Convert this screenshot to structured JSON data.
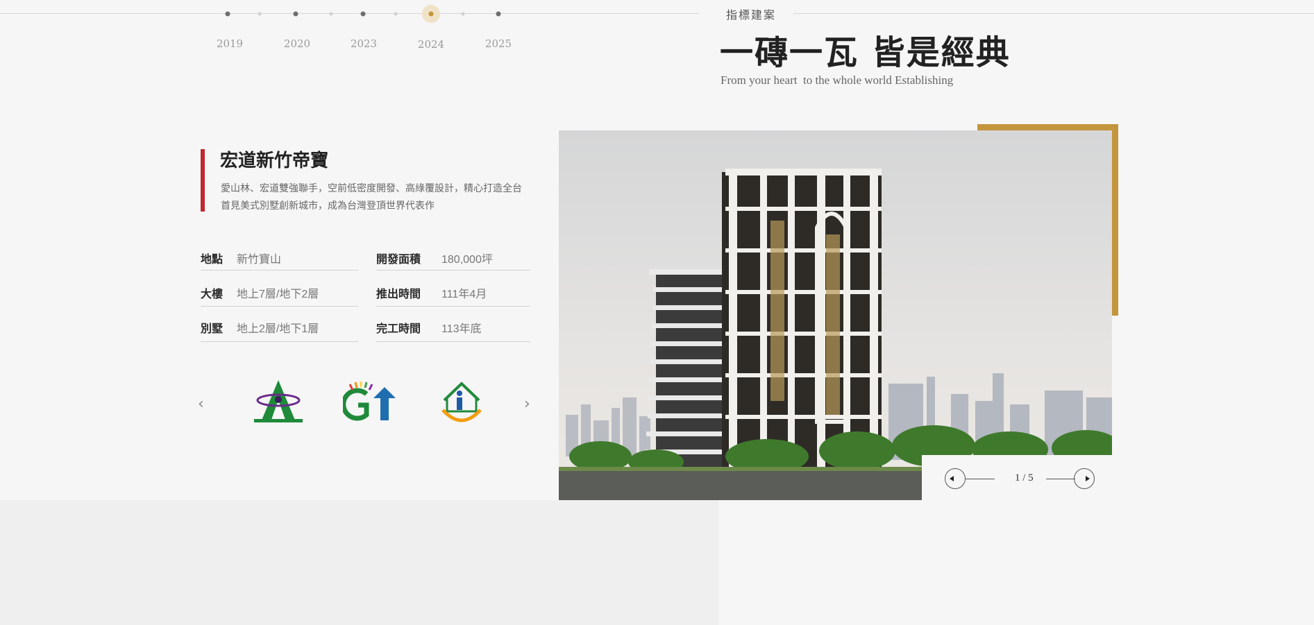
{
  "timeline": {
    "years": [
      "2019",
      "2020",
      "2023",
      "2024",
      "2025"
    ],
    "active_year": "2024"
  },
  "header": {
    "eyebrow": "指標建案",
    "title": "一磚一瓦 皆是經典",
    "subtitle": "From your heart  to the whole world Establishing"
  },
  "project": {
    "title": "宏道新竹帝寶",
    "description": "愛山林、宏道雙強聯手，空前低密度開發、高綠覆設計，精心打造全台首見美式別墅創新城市，成為台灣登頂世界代表作",
    "specs": [
      {
        "label": "地點",
        "value": "新竹寶山"
      },
      {
        "label": "開發面積",
        "value": "180,000坪"
      },
      {
        "label": "大樓",
        "value": "地上7層/地下2層"
      },
      {
        "label": "推出時間",
        "value": "111年4月"
      },
      {
        "label": "別墅",
        "value": "地上2層/地下1層"
      },
      {
        "label": "完工時間",
        "value": "113年底"
      }
    ]
  },
  "logos": {
    "prev_glyph": "‹",
    "next_glyph": "›",
    "items": [
      "logo-a-green",
      "logo-gt-house",
      "logo-i-house"
    ]
  },
  "gallery": {
    "counter": "1 / 5"
  },
  "colors": {
    "accent_gold": "#c3953c",
    "accent_red": "#c0282e",
    "background": "#f6f6f6"
  }
}
